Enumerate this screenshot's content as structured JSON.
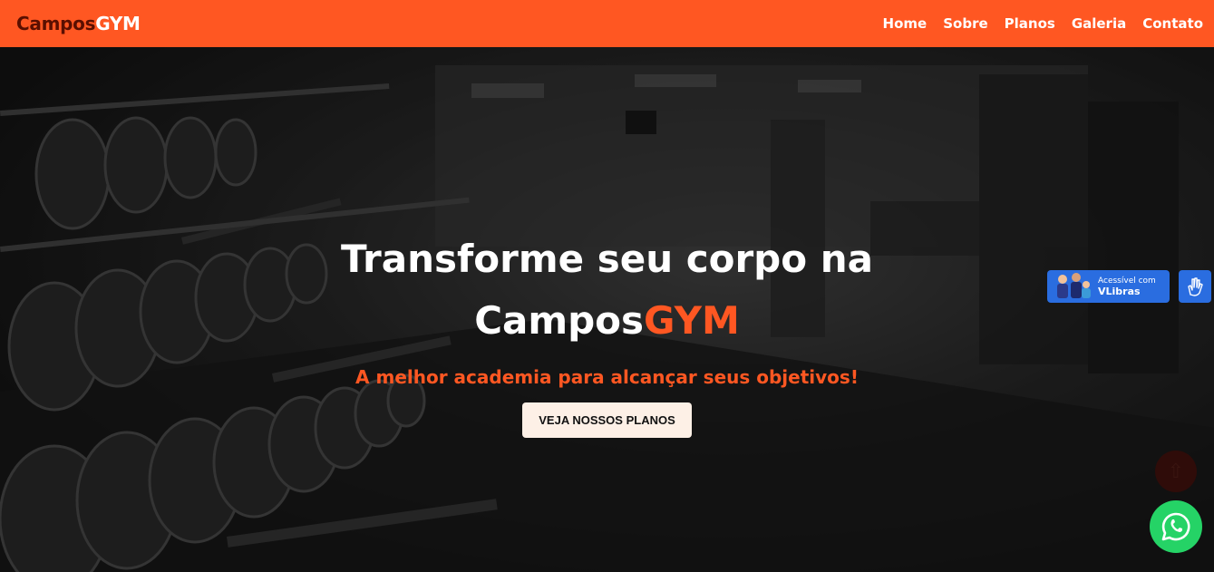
{
  "brand": {
    "part1": "Campos",
    "part2": "GYM"
  },
  "nav": {
    "items": [
      {
        "label": "Home"
      },
      {
        "label": "Sobre"
      },
      {
        "label": "Planos"
      },
      {
        "label": "Galeria"
      },
      {
        "label": "Contato"
      }
    ]
  },
  "hero": {
    "title_line": "Transforme seu corpo na",
    "title_brand_part1": "Campos",
    "title_brand_part2": "GYM",
    "subtitle": "A melhor academia para alcançar seus objetivos!",
    "cta_label": "VEJA NOSSOS PLANOS"
  },
  "accessibility": {
    "vlibras_small": "Acessível com",
    "vlibras_big": "VLibras",
    "icon": "sign-language-hand-icon"
  },
  "floating": {
    "scroll_top_icon": "arrow-up-icon",
    "whatsapp_icon": "whatsapp-icon"
  },
  "colors": {
    "accent": "#ff5722",
    "brand_dark": "#5a0f00",
    "cta_bg": "#fdf0e6",
    "vlibras_blue": "#2a6de0",
    "whatsapp_green": "#25d366"
  }
}
